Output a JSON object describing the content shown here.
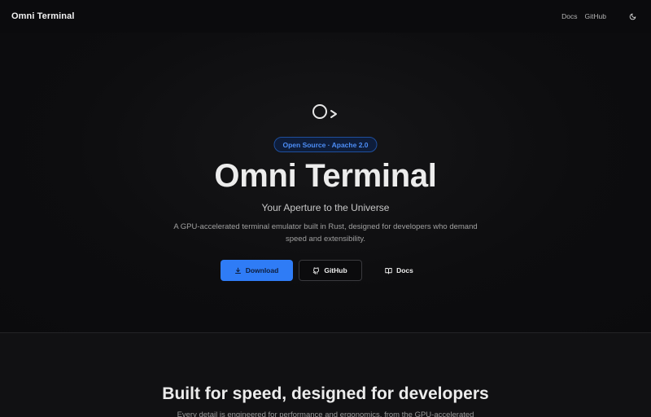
{
  "header": {
    "brand": "Omni Terminal",
    "nav": {
      "docs": "Docs",
      "github": "GitHub"
    },
    "theme_toggle_icon": "moon-icon"
  },
  "hero": {
    "logo_icon": "aperture-prompt-logo",
    "badge": "Open Source · Apache 2.0",
    "title": "Omni Terminal",
    "tagline": "Your Aperture to the Universe",
    "description": "A GPU-accelerated terminal emulator built in Rust, designed for developers who demand speed and extensibility.",
    "buttons": {
      "download": {
        "label": "Download",
        "icon": "download-icon"
      },
      "github": {
        "label": "GitHub",
        "icon": "github-icon"
      },
      "docs": {
        "label": "Docs",
        "icon": "book-icon"
      }
    }
  },
  "features": {
    "title": "Built for speed, designed for developers",
    "subtitle": "Every detail is engineered for performance and ergonomics, from the GPU-accelerated"
  },
  "colors": {
    "background": "#0b0b0d",
    "accent": "#2f7cf6",
    "badge_text": "#4d8ef7",
    "section_background": "#111113"
  }
}
